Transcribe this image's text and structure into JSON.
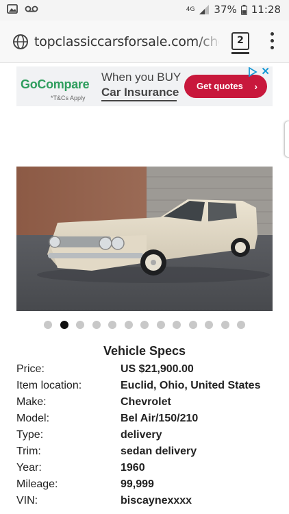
{
  "status_bar": {
    "network": "4G",
    "battery": "37%",
    "time": "11:28"
  },
  "browser": {
    "url": "topclassiccarsforsale.com/chevr",
    "tab_count": "2"
  },
  "ad": {
    "brand": "GoCompare",
    "terms": "*T&Cs Apply",
    "line1": "When you BUY",
    "line2": "Car Insurance",
    "cta": "Get quotes",
    "cta_arrow": "›",
    "close": "✕"
  },
  "gallery": {
    "image_count": 13,
    "active_index": 1
  },
  "specs": {
    "title": "Vehicle Specs",
    "rows": [
      {
        "label": "Price:",
        "value": "US $21,900.00"
      },
      {
        "label": "Item location:",
        "value": "Euclid, Ohio, United States"
      },
      {
        "label": "Make:",
        "value": "Chevrolet"
      },
      {
        "label": "Model:",
        "value": "Bel Air/150/210"
      },
      {
        "label": "Type:",
        "value": "delivery"
      },
      {
        "label": "Trim:",
        "value": "sedan delivery"
      },
      {
        "label": "Year:",
        "value": "1960"
      },
      {
        "label": "Mileage:",
        "value": "99,999"
      },
      {
        "label": "VIN:",
        "value": "biscaynexxxx"
      }
    ]
  },
  "colors": {
    "ad_green": "#2f9e5e",
    "ad_button": "#c8183c",
    "dot_active": "#111111",
    "dot_inactive": "#c8c8c8"
  }
}
